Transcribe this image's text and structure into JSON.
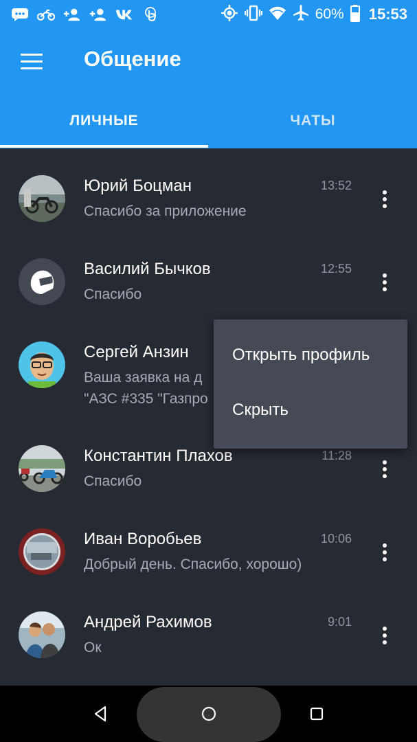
{
  "status_bar": {
    "battery": "60%",
    "time": "15:53",
    "left_icons": [
      "chat-bubble-icon",
      "motorcycle-icon",
      "add-person-icon",
      "add-person-icon",
      "vk-icon",
      "touch-icon"
    ],
    "right_icons": [
      "location-icon",
      "vibrate-icon",
      "wifi-icon",
      "airplane-icon",
      "battery-icon"
    ]
  },
  "app_bar": {
    "title": "Общение",
    "menu_icon": "hamburger-menu-icon",
    "color": "#2196f3"
  },
  "tabs": [
    {
      "label": "ЛИЧНЫЕ",
      "selected": true
    },
    {
      "label": "ЧАТЫ",
      "selected": false
    }
  ],
  "conversations": [
    {
      "name": "Юрий Боцман",
      "message": "Спасибо за приложение",
      "time": "13:52",
      "avatar": "photo-motorcycle-avatar"
    },
    {
      "name": "Василий Бычков",
      "message": "Спасибо",
      "time": "12:55",
      "avatar": "helmet-icon"
    },
    {
      "name": "Сергей Анзин",
      "message_line1": "Ваша заявка на д",
      "message_line2": "\"АЗС #335 \"Газпро",
      "time": "",
      "avatar": "cartoon-face-avatar"
    },
    {
      "name": "Константин Плахов",
      "message": "Спасибо",
      "time": "11:28",
      "avatar": "photo-motorcycles-avatar"
    },
    {
      "name": "Иван Воробьев",
      "message": "Добрый день. Спасибо, хорошо)",
      "time": "10:06",
      "avatar": "photo-mirror-avatar"
    },
    {
      "name": "Андрей Рахимов",
      "message": "Ок",
      "time": "9:01",
      "avatar": "photo-people-avatar"
    }
  ],
  "context_menu": {
    "items": [
      "Открыть профиль",
      "Скрыть"
    ]
  },
  "nav_bar": {
    "buttons": [
      "back-icon",
      "home-icon",
      "recents-icon"
    ]
  }
}
